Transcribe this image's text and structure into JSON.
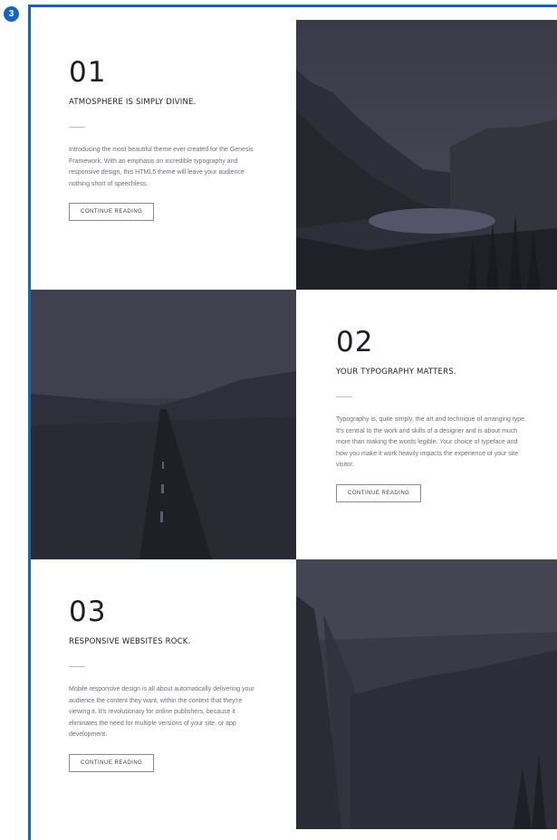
{
  "step_badge": "3",
  "sections": [
    {
      "number": "01",
      "heading": "ATMOSPHERE IS SIMPLY DIVINE.",
      "body": "Introducing the most beautiful theme ever created for the Genesis Framework. With an emphasis on incredible typography and responsive design, this HTML5 theme will leave your audience nothing short of speechless.",
      "button": "CONTINUE READING",
      "image": "mountain-lake-photo"
    },
    {
      "number": "02",
      "heading": "YOUR TYPOGRAPHY MATTERS.",
      "body": "Typography is, quite simply, the art and technique of arranging type. It's central to the work and skills of a designer and is about much more than making the words legible. Your choice of typeface and how you make it work heavily impacts the experience of your site visitor.",
      "button": "CONTINUE READING",
      "image": "open-road-photo"
    },
    {
      "number": "03",
      "heading": "RESPONSIVE WEBSITES ROCK.",
      "body": "Mobile responsive design is all about automatically delivering your audience the content they want, within the context that they're viewing it. It's revolutionary for online publishers, because it eliminates the need for multiple versions of your site, or app development.",
      "button": "CONTINUE READING",
      "image": "canyon-cliff-photo"
    }
  ],
  "colors": {
    "accent_border": "#1565c0",
    "photo_overlay": "#2a2a36",
    "heading_text": "#1d1d26",
    "body_text": "#6e6e78"
  }
}
